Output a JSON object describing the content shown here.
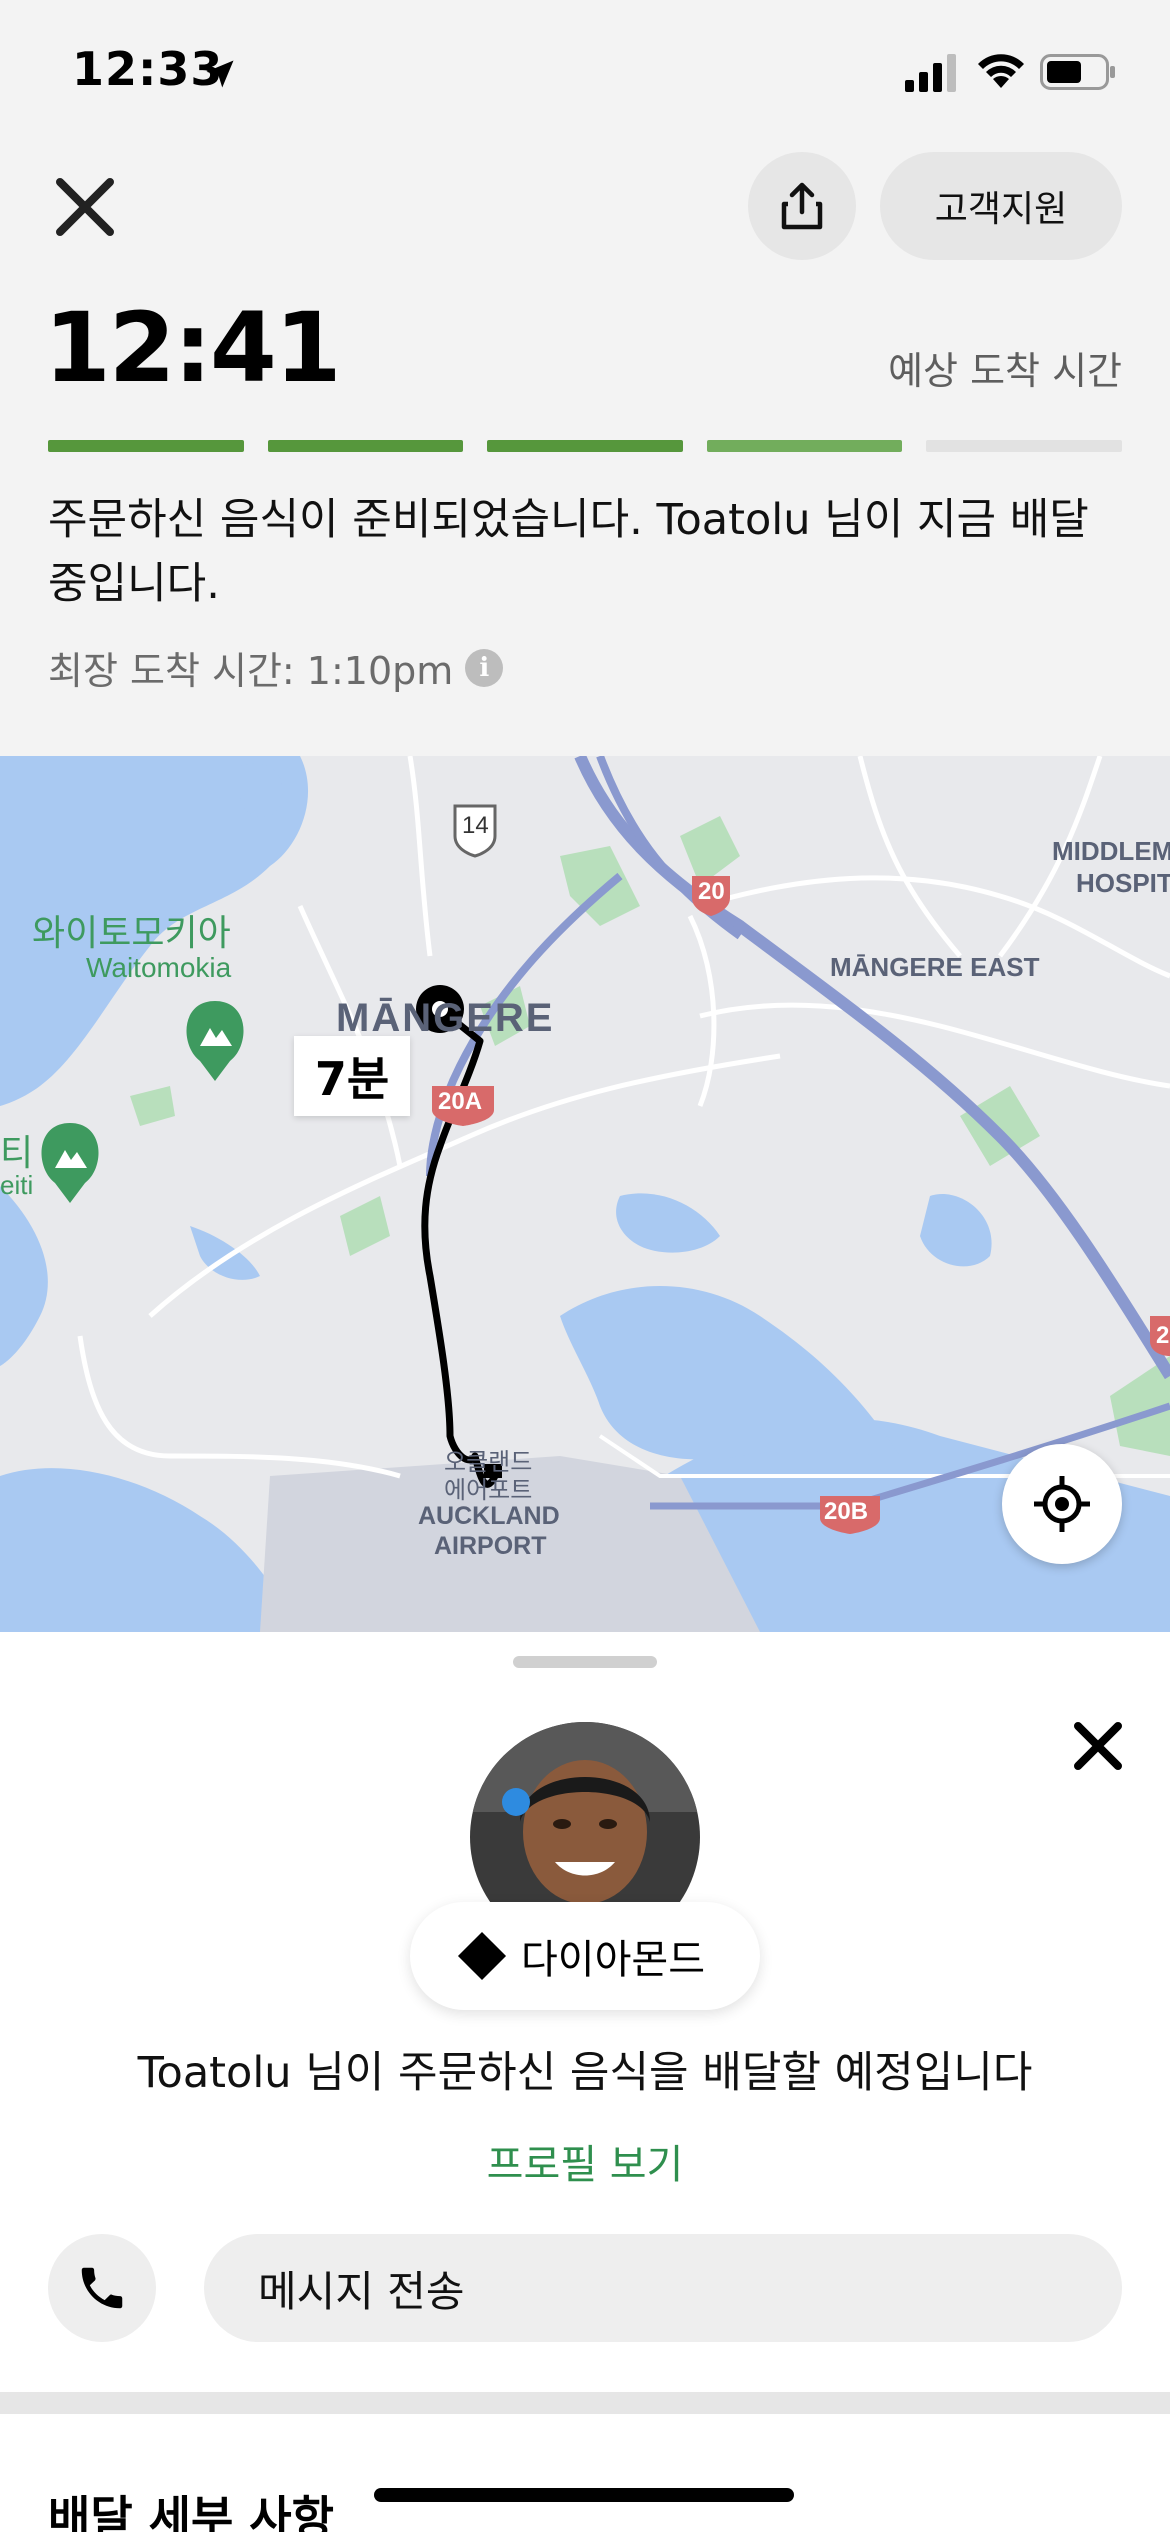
{
  "status_bar": {
    "time": "12:33"
  },
  "header": {
    "support_label": "고객지원",
    "eta_time": "12:41",
    "eta_label": "예상 도착 시간",
    "progress": {
      "segments_total": 5,
      "segments_complete": 4,
      "active_segment": 4
    },
    "status_message": "주문하신 음식이 준비되었습니다. Toatolu 님이 지금 배달 중입니다.",
    "latest_arrival": "최장 도착 시간: 1:10pm",
    "info_glyph": "i"
  },
  "map": {
    "eta_bubble": "7분",
    "labels": {
      "waitomokia_ko": "와이토모키아",
      "waitomokia_en": "Waitomokia",
      "mangere": "MĀNGERE",
      "mangere_east": "MĀNGERE EAST",
      "middlemore_1": "MIDDLEM",
      "middlemore_2": "HOSPIT",
      "airport_ko_1": "오클랜드",
      "airport_ko_2": "에어포트",
      "airport_en_1": "AUCKLAND",
      "airport_en_2": "AIRPORT",
      "partial_ko": "티",
      "partial_en": "eiti"
    },
    "road_shields": {
      "r14": "14",
      "r20": "20",
      "r20a": "20A",
      "r20b": "20B",
      "r2": "2"
    }
  },
  "courier": {
    "rank_label": "다이아몬드",
    "message": "Toatolu 님이 주문하신 음식을 배달할 예정입니다",
    "profile_link": "프로필 보기",
    "message_button": "메시지 전송"
  },
  "details": {
    "title": "배달 세부 사항"
  },
  "colors": {
    "progress_done": "#56973c",
    "progress_active": "#72ad5c",
    "progress_pending": "#e2e2e2",
    "link_green": "#2f8f4e"
  }
}
